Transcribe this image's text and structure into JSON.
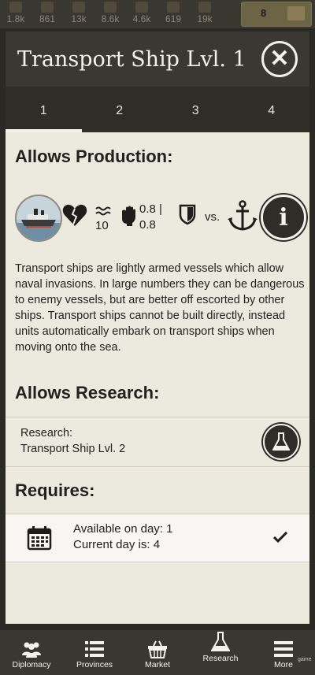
{
  "resources": [
    {
      "icon": "wood-icon",
      "value": "1.8k"
    },
    {
      "icon": "crate-icon",
      "value": "861"
    },
    {
      "icon": "stone-icon",
      "value": "13k"
    },
    {
      "icon": "iron-icon",
      "value": "8.6k"
    },
    {
      "icon": "oil-icon",
      "value": "4.6k"
    },
    {
      "icon": "rare-material-icon",
      "value": "619"
    },
    {
      "icon": "cash-icon",
      "value": "19k"
    }
  ],
  "gold": {
    "value": "8",
    "icon": "gold-chest-icon"
  },
  "dialog": {
    "title": "Transport Ship Lvl. 1",
    "tabs": [
      "1",
      "2",
      "3",
      "4"
    ],
    "active_tab": "1"
  },
  "production": {
    "heading": "Allows Production:",
    "health_icon": "broken-heart-icon",
    "speed_value": "10",
    "attack_value_1": "0.8 |",
    "attack_value_2": "0.8",
    "versus_label": "vs.",
    "target_icon": "anchor-icon",
    "description": "Transport ships are lightly armed vessels which allow naval invasions. In large numbers they can be dangerous to enemy vessels, but are better off escorted by other ships. Transport ships cannot be built directly, instead units automatically embark on transport ships when moving onto the sea."
  },
  "research": {
    "heading": "Allows Research:",
    "label": "Research:",
    "item": "Transport Ship Lvl. 2"
  },
  "requires": {
    "heading": "Requires:",
    "line1": "Available on day: 1",
    "line2": "Current day is: 4",
    "status": "met"
  },
  "navbar": [
    {
      "label": "Diplomacy",
      "icon": "diplomacy-icon"
    },
    {
      "label": "Provinces",
      "icon": "provinces-list-icon"
    },
    {
      "label": "Market",
      "icon": "market-basket-icon"
    },
    {
      "label": "Research",
      "icon": "research-flask-icon"
    },
    {
      "label": "More",
      "icon": "hamburger-menu-icon"
    }
  ],
  "watermark": "game",
  "colors": {
    "header": "#3b3833",
    "panel": "#ece9df",
    "text": "#23211d"
  }
}
